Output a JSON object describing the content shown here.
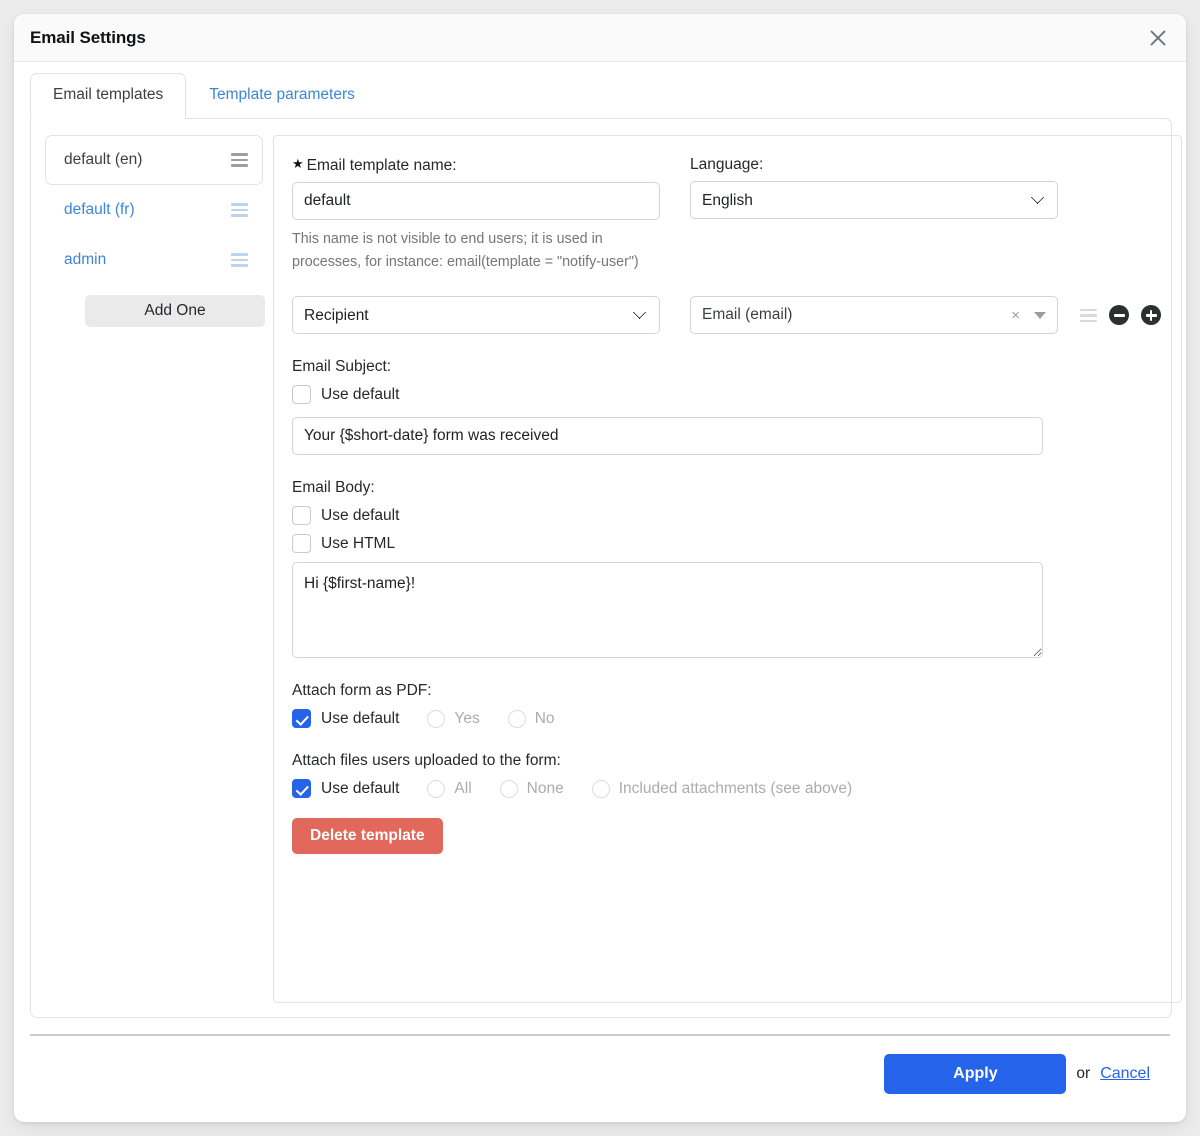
{
  "window": {
    "title": "Email Settings",
    "close_icon": "close-icon"
  },
  "tabs": [
    {
      "label": "Email templates",
      "active": true
    },
    {
      "label": "Template parameters",
      "active": false
    }
  ],
  "sidebar": {
    "items": [
      {
        "label": "default (en)",
        "active": true
      },
      {
        "label": "default (fr)",
        "active": false
      },
      {
        "label": "admin",
        "active": false
      }
    ],
    "add_button": "Add One"
  },
  "form": {
    "name_label": "Email template name:",
    "name_required_marker": "★",
    "name_value": "default",
    "name_help": "This name is not visible to end users; it is used in processes, for instance: email(template = \"notify-user\")",
    "language_label": "Language:",
    "language_value": "English",
    "language_options": [
      "English"
    ],
    "recipient_select_value": "Recipient",
    "recipient_select_options": [
      "Recipient"
    ],
    "recipient_field_value": "Email (email)",
    "recipient_clear_icon": "×",
    "subject": {
      "label": "Email Subject:",
      "use_default_label": "Use default",
      "use_default_checked": false,
      "value": "Your {$short-date} form was received"
    },
    "body": {
      "label": "Email Body:",
      "use_default_label": "Use default",
      "use_default_checked": false,
      "use_html_label": "Use HTML",
      "use_html_checked": false,
      "value": "Hi {$first-name}!"
    },
    "attach_pdf": {
      "label": "Attach form as PDF:",
      "use_default_label": "Use default",
      "use_default_checked": true,
      "options": [
        "Yes",
        "No"
      ]
    },
    "attach_files": {
      "label": "Attach files users uploaded to the form:",
      "use_default_label": "Use default",
      "use_default_checked": true,
      "options": [
        "All",
        "None",
        "Included attachments (see above)"
      ]
    },
    "delete_button": "Delete template"
  },
  "footer": {
    "apply_label": "Apply",
    "or_label": "or",
    "cancel_label": "Cancel"
  },
  "colors": {
    "accent_blue": "#2563eb",
    "link_blue": "#3c86d8",
    "danger_red": "#e2685c",
    "page_bg": "#ececed"
  }
}
